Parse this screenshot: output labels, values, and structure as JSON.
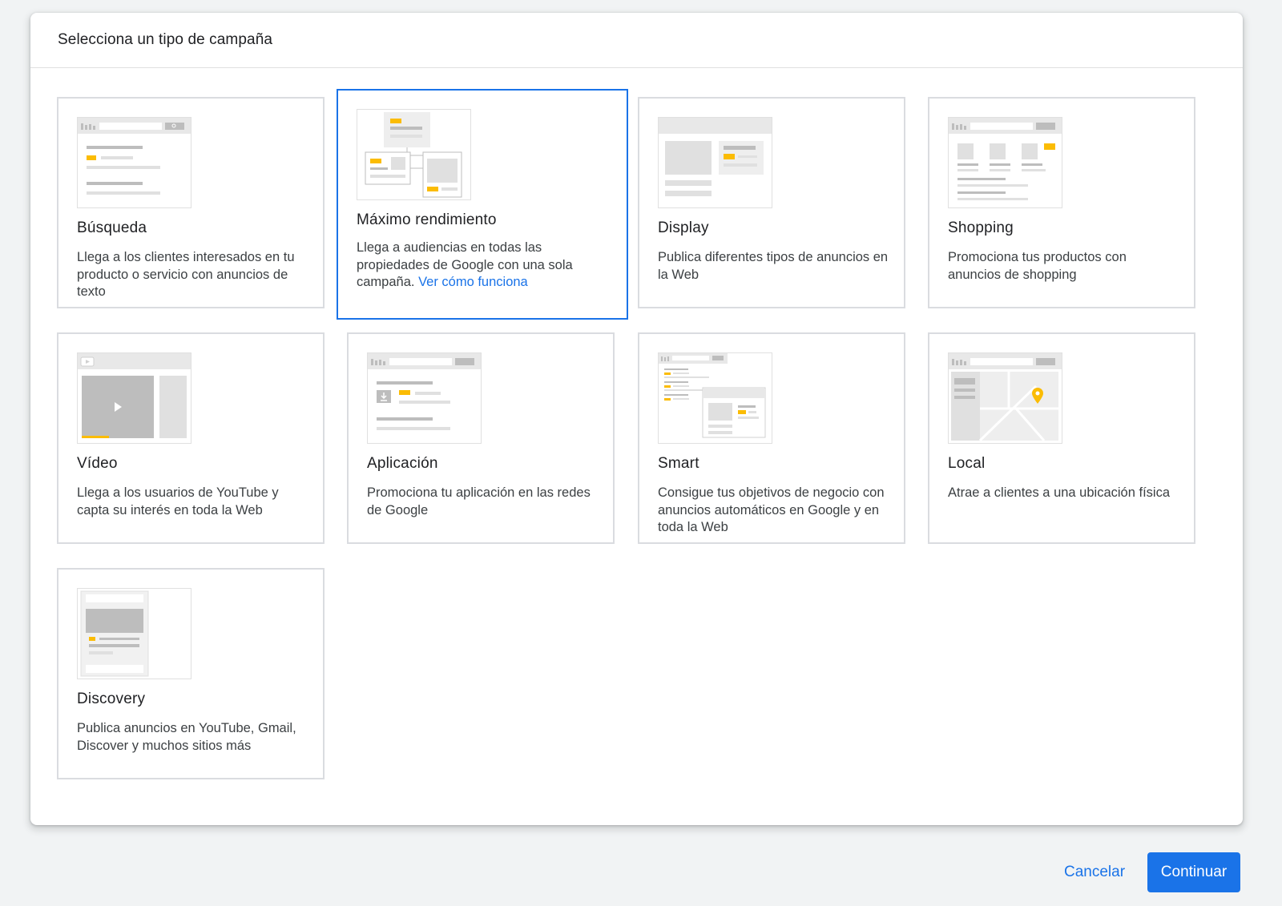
{
  "dialog": {
    "title": "Selecciona un tipo de campaña"
  },
  "campaigns": [
    {
      "id": "search",
      "title": "Búsqueda",
      "description": "Llega a los clientes interesados en tu producto o servicio con anuncios de texto"
    },
    {
      "id": "pmax",
      "title": "Máximo rendimiento",
      "description": "Llega a audiencias en todas las propiedades de Google con una sola campaña.",
      "link": "Ver cómo funciona",
      "selected": true
    },
    {
      "id": "display",
      "title": "Display",
      "description": "Publica diferentes tipos de anuncios en la Web"
    },
    {
      "id": "shopping",
      "title": "Shopping",
      "description": "Promociona tus productos con anuncios de shopping"
    },
    {
      "id": "video",
      "title": "Vídeo",
      "description": "Llega a los usuarios de YouTube y capta su interés en toda la Web"
    },
    {
      "id": "app",
      "title": "Aplicación",
      "description": "Promociona tu aplicación en las redes de Google"
    },
    {
      "id": "smart",
      "title": "Smart",
      "description": "Consigue tus objetivos de negocio con anuncios automáticos en Google y en toda la Web"
    },
    {
      "id": "local",
      "title": "Local",
      "description": "Atrae a clientes a una ubicación física"
    },
    {
      "id": "discovery",
      "title": "Discovery",
      "description": "Publica anuncios en YouTube, Gmail, Discover y muchos sitios más"
    }
  ],
  "footer": {
    "cancel_label": "Cancelar",
    "continue_label": "Continuar"
  },
  "colors": {
    "accent": "#1a73e8",
    "highlight": "#fbbc04",
    "border": "#dadce0",
    "placeholder": "#e0e0e0"
  }
}
